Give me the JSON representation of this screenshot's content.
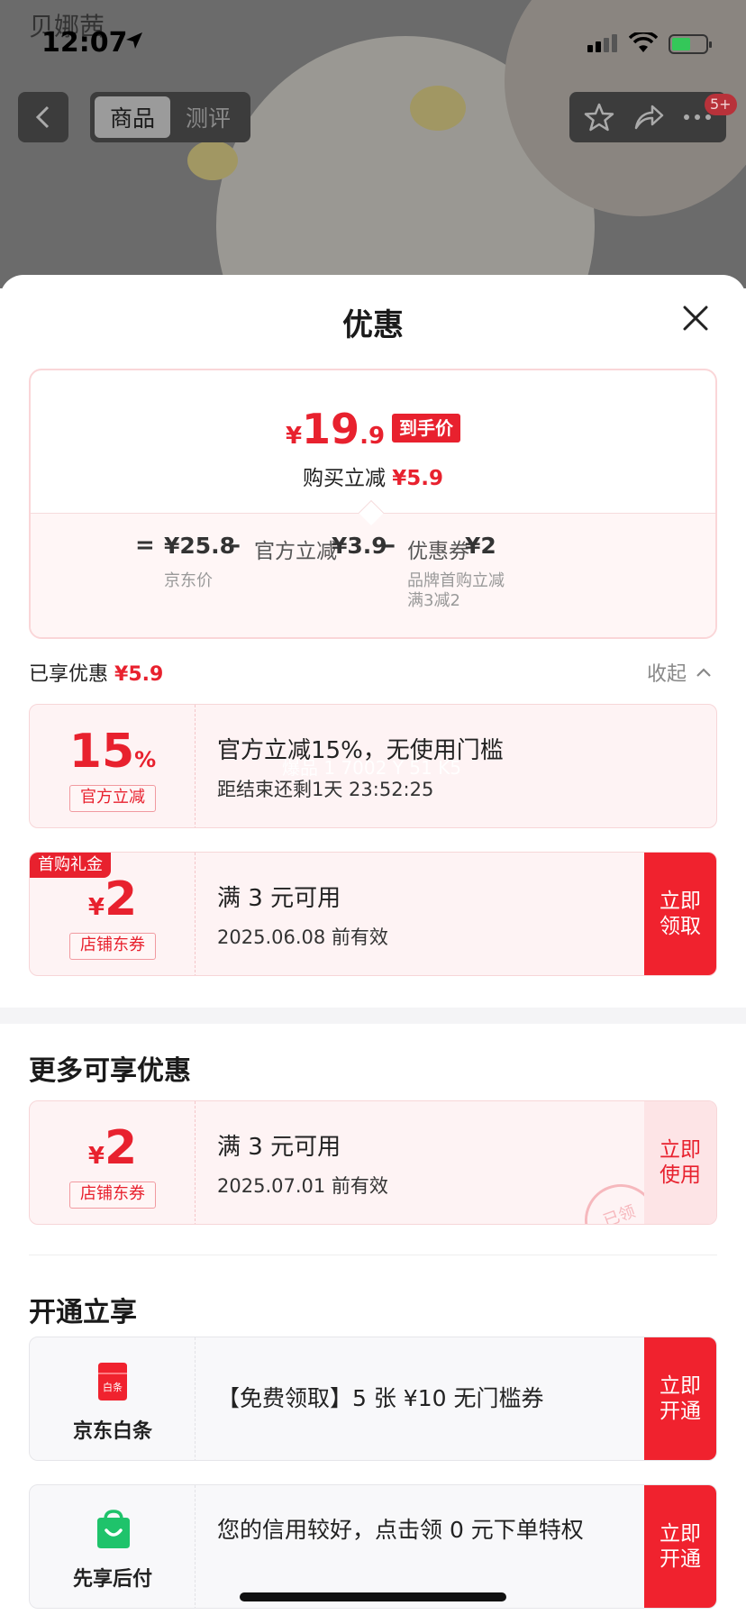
{
  "status_bar": {
    "time": "12:07"
  },
  "background_page": {
    "brand_text": "贝娜茜",
    "tabs": [
      {
        "label": "商品",
        "active": true
      },
      {
        "label": "测评",
        "active": false
      }
    ],
    "badge": "5+",
    "icons": [
      "back-icon",
      "star-icon",
      "share-icon",
      "more-icon"
    ]
  },
  "sheet": {
    "title": "优惠",
    "summary": {
      "price_symbol": "¥",
      "price_int": "19",
      "price_dec": ".9",
      "price_tag": "到手价",
      "save_label": "购买立减",
      "save_amount": "¥5.9",
      "formula": {
        "eq": "=",
        "base_price": "¥25.8",
        "base_label": "京东价",
        "minus1": "–",
        "official_label": "官方立减",
        "official_amount": "¥3.9",
        "minus2": "–",
        "coupon_label": "优惠券",
        "coupon_amount": "¥2",
        "coupon_note_1": "品牌首购立减",
        "coupon_note_2": "满3减2"
      }
    },
    "enjoyed": {
      "label": "已享优惠",
      "amount": "¥5.9",
      "collapse": "收起"
    },
    "enjoyed_coupons": [
      {
        "value": "15",
        "unit": "%",
        "kind": "官方立减",
        "title": "官方立减15%，无使用门槛",
        "sub": "距结束还剩1天 23:52:25",
        "watermark": "爆品 1 7002 Y 51 K5"
      },
      {
        "ribbon": "首购礼金",
        "symbol": "¥",
        "value": "2",
        "kind": "店铺东券",
        "title": "满 3 元可用",
        "sub": "2025.06.08 前有效",
        "button": "立即\n领取"
      }
    ],
    "more": {
      "title": "更多可享优惠",
      "coupon": {
        "symbol": "¥",
        "value": "2",
        "kind": "店铺东券",
        "title": "满 3 元可用",
        "sub": "2025.07.01 前有效",
        "button": "立即\n使用",
        "stamp": "已领"
      }
    },
    "open": {
      "title": "开通立享",
      "items": [
        {
          "name": "京东白条",
          "logo_text": "白条",
          "text": "【免费领取】5 张 ¥10 无门槛券",
          "button": "立即\n开通",
          "color": "#f0222e"
        },
        {
          "name": "先享后付",
          "text": "您的信用较好，点击领 0 元下单特权",
          "button": "立即\n开通",
          "color": "#1fc36b"
        }
      ]
    }
  },
  "colors": {
    "accent": "#e8212e",
    "coupon_bg": "#fef3f4"
  }
}
